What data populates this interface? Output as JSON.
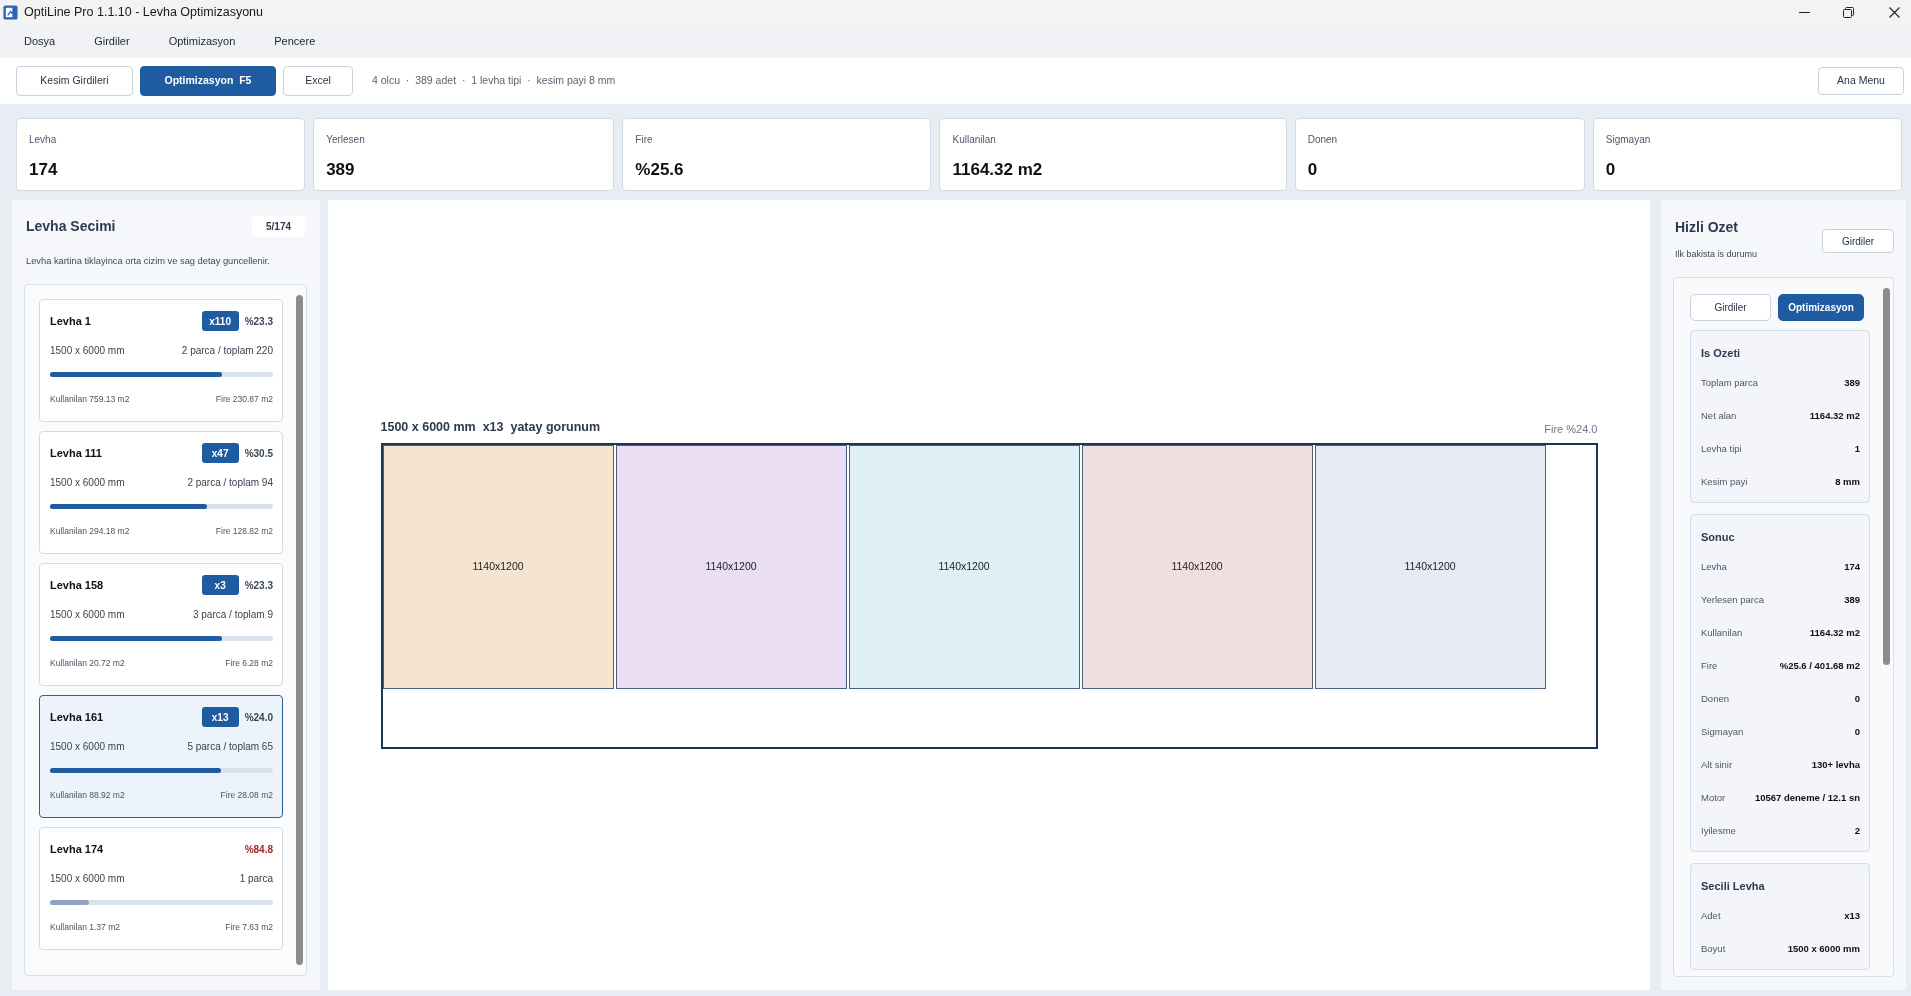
{
  "window": {
    "title": "OptiLine Pro 1.1.10 - Levha Optimizasyonu"
  },
  "menu": [
    "Dosya",
    "Girdiler",
    "Optimizasyon",
    "Pencere"
  ],
  "toolbar": {
    "buttons": [
      {
        "label": "Kesim Girdileri",
        "selected": false
      },
      {
        "label": "Optimizasyon  F5",
        "selected": true
      },
      {
        "label": "Excel",
        "selected": false
      }
    ],
    "summary": "4 olcu  ·  389 adet  ·  1 levha tipi  ·  kesim payi 8 mm",
    "home_button": "Ana Menu"
  },
  "stats": [
    {
      "label": "Levha",
      "value": "174"
    },
    {
      "label": "Yerlesen",
      "value": "389"
    },
    {
      "label": "Fire",
      "value": "%25.6"
    },
    {
      "label": "Kullanilan",
      "value": "1164.32 m2"
    },
    {
      "label": "Donen",
      "value": "0"
    },
    {
      "label": "Sigmayan",
      "value": "0"
    }
  ],
  "sheet_list": {
    "title": "Levha Secimi",
    "count": "5/174",
    "hint": "Levha kartina tiklayinca orta cizim ve sag detay guncellenir.",
    "items": [
      {
        "name": "Levha 1",
        "multiplier": "x110",
        "waste": "%23.3",
        "warning": false,
        "size": "1500 x 6000 mm",
        "parts": "2 parca / toplam 220",
        "level": 0.77,
        "used": "Kullanilan 759.13 m2",
        "fire": "Fire 230.87 m2",
        "selected": false
      },
      {
        "name": "Levha 111",
        "multiplier": "x47",
        "waste": "%30.5",
        "warning": false,
        "size": "1500 x 6000 mm",
        "parts": "2 parca / toplam 94",
        "level": 0.705,
        "used": "Kullanilan 294.18 m2",
        "fire": "Fire 128.82 m2",
        "selected": false
      },
      {
        "name": "Levha 158",
        "multiplier": "x3",
        "waste": "%23.3",
        "warning": false,
        "size": "1500 x 6000 mm",
        "parts": "3 parca / toplam 9",
        "level": 0.77,
        "used": "Kullanilan 20.72 m2",
        "fire": "Fire 6.28 m2",
        "selected": false
      },
      {
        "name": "Levha 161",
        "multiplier": "x13",
        "waste": "%24.0",
        "warning": false,
        "size": "1500 x 6000 mm",
        "parts": "5 parca / toplam 65",
        "level": 0.765,
        "used": "Kullanilan 88.92 m2",
        "fire": "Fire 28.08 m2",
        "selected": true
      },
      {
        "name": "Levha 174",
        "waste": "%84.8",
        "warning": true,
        "size": "1500 x 6000 mm",
        "parts": "1 parca",
        "level": 0.175,
        "used": "Kullanilan 1.37 m2",
        "fire": "Fire 7.63 m2",
        "selected": false
      }
    ]
  },
  "layout_view": {
    "title": "1500 x 6000 mm  x13  yatay gorunum",
    "waste": "Fire %24.0",
    "pieces": [
      {
        "label": "1140x1200",
        "color": "#f5e4cf"
      },
      {
        "label": "1140x1200",
        "color": "#eadef5"
      },
      {
        "label": "1140x1200",
        "color": "#dff0f4"
      },
      {
        "label": "1140x1200",
        "color": "#f0dfe0"
      },
      {
        "label": "1140x1200",
        "color": "#e5eaf3"
      }
    ]
  },
  "summary_panel": {
    "title": "Hizli Ozet",
    "subtitle": "Ilk bakista is durumu",
    "button": "Girdiler",
    "tabs": [
      {
        "label": "Girdiler",
        "selected": false
      },
      {
        "label": "Optimizasyon",
        "selected": true
      }
    ],
    "sections": [
      {
        "title": "Is Ozeti",
        "rows": [
          {
            "label": "Toplam parca",
            "value": "389"
          },
          {
            "label": "Net alan",
            "value": "1164.32 m2"
          },
          {
            "label": "Levha tipi",
            "value": "1"
          },
          {
            "label": "Kesim payi",
            "value": "8 mm"
          }
        ]
      },
      {
        "title": "Sonuc",
        "rows": [
          {
            "label": "Levha",
            "value": "174"
          },
          {
            "label": "Yerlesen parca",
            "value": "389"
          },
          {
            "label": "Kullanilan",
            "value": "1164.32 m2"
          },
          {
            "label": "Fire",
            "value": "%25.6 / 401.68 m2"
          },
          {
            "label": "Donen",
            "value": "0"
          },
          {
            "label": "Sigmayan",
            "value": "0"
          },
          {
            "label": "Alt sinir",
            "value": "130+ levha"
          },
          {
            "label": "Motor",
            "value": "10567 deneme / 12.1 sn"
          },
          {
            "label": "Iyilesme",
            "value": "2"
          }
        ]
      },
      {
        "title": "Secili Levha",
        "rows": [
          {
            "label": "Adet",
            "value": "x13"
          },
          {
            "label": "Boyut",
            "value": "1500 x 6000 mm"
          }
        ]
      }
    ]
  }
}
